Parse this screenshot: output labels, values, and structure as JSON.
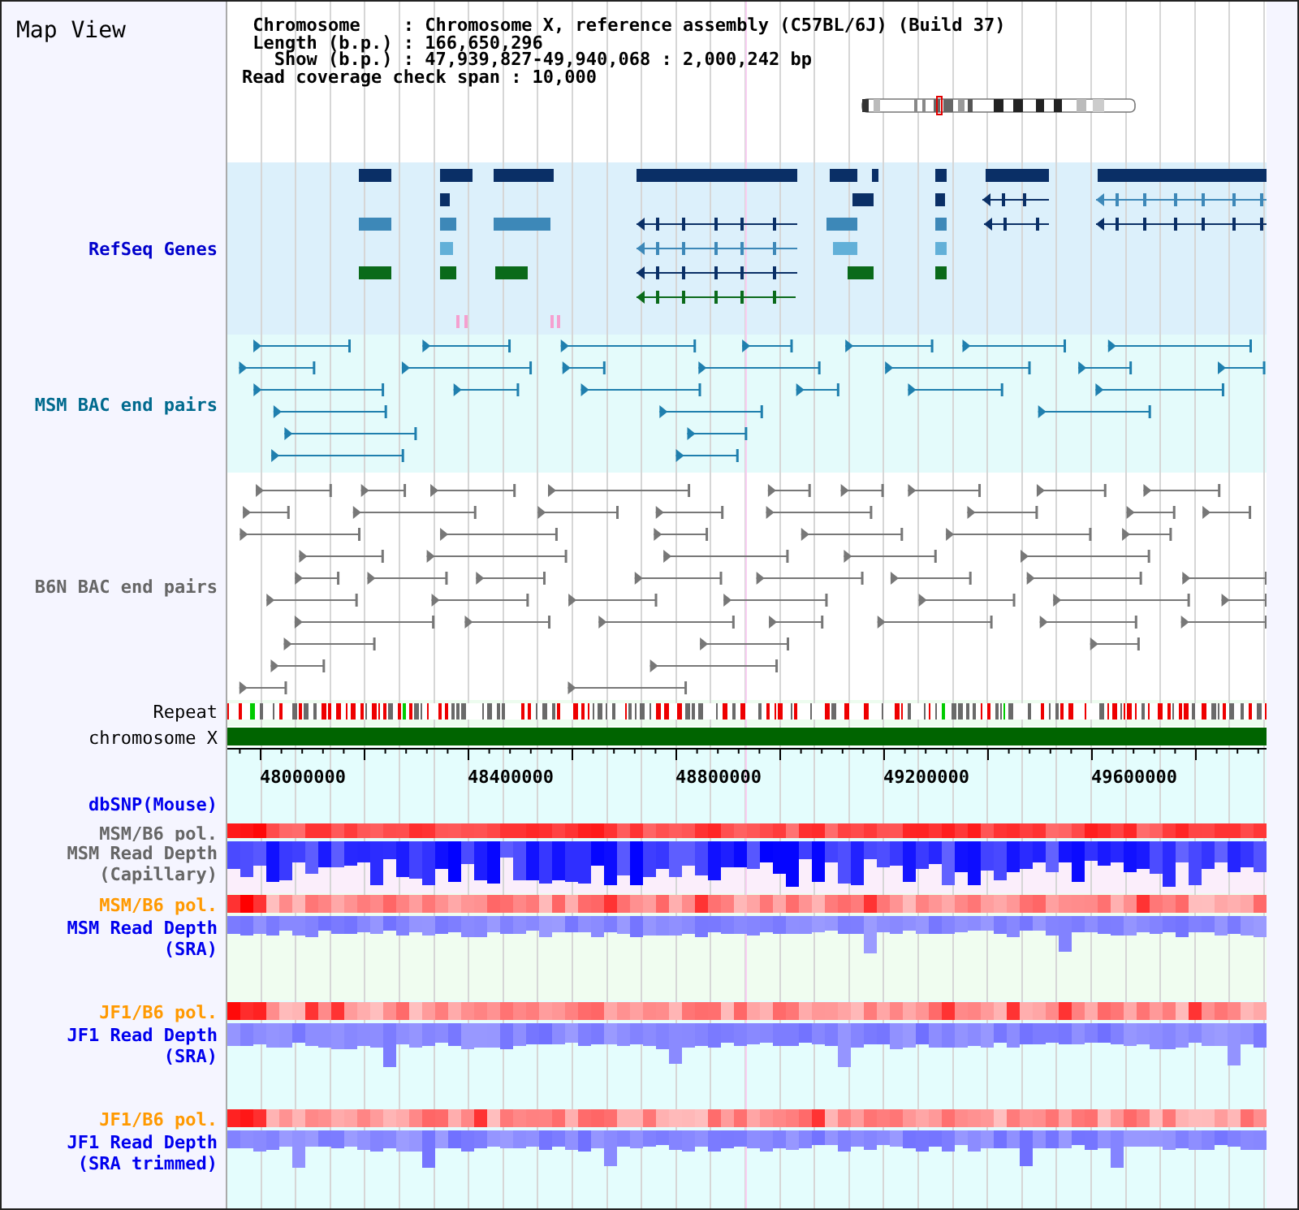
{
  "title": "Map View",
  "info_lines": [
    " Chromosome    : Chromosome X, reference assembly (C57BL/6J) (Build 37)",
    " Length (b.p.) : 166,650,296",
    "   Show (b.p.) : 47,939,827-49,940,068 : 2,000,242 bp",
    "Read coverage check span : 10,000"
  ],
  "tracks": [
    {
      "kind": "genes",
      "label": [
        "RefSeq Genes"
      ],
      "color": "#0000cc"
    },
    {
      "kind": "pairs",
      "label": [
        "MSM BAC end pairs"
      ],
      "color": "#006a8e"
    },
    {
      "kind": "pairs",
      "label": [
        "B6N BAC end pairs"
      ],
      "color": "#666666"
    },
    {
      "kind": "repeat",
      "label": [
        "Repeat"
      ],
      "color": "#000000"
    },
    {
      "kind": "chromosome",
      "label": [
        "chromosome X"
      ],
      "color": "#000000"
    },
    {
      "kind": "axis",
      "ticks": [
        "48000000",
        "48400000",
        "48800000",
        "49200000",
        "49600000"
      ]
    },
    {
      "kind": "snp",
      "label": [
        "dbSNP(Mouse)"
      ],
      "color": "#0000ee"
    },
    {
      "kind": "polymorphism",
      "label": [
        "MSM/B6 pol."
      ],
      "color": "#666666"
    },
    {
      "kind": "depth",
      "label": [
        "MSM Read Depth",
        "(Capillary)"
      ],
      "color": "#666666"
    },
    {
      "kind": "polymorphism",
      "label": [
        "MSM/B6 pol."
      ],
      "color": "#ff9900"
    },
    {
      "kind": "depth",
      "label": [
        "MSM Read Depth",
        "(SRA)"
      ],
      "color": "#0000ee"
    },
    {
      "kind": "polymorphism",
      "label": [
        "JF1/B6 pol."
      ],
      "color": "#ff9900"
    },
    {
      "kind": "depth",
      "label": [
        "JF1 Read Depth",
        "(SRA)"
      ],
      "color": "#0000ee"
    },
    {
      "kind": "polymorphism",
      "label": [
        "JF1/B6 pol."
      ],
      "color": "#ff9900"
    },
    {
      "kind": "depth",
      "label": [
        "JF1 Read Depth",
        "(SRA trimmed)"
      ],
      "color": "#0000ee"
    }
  ]
}
